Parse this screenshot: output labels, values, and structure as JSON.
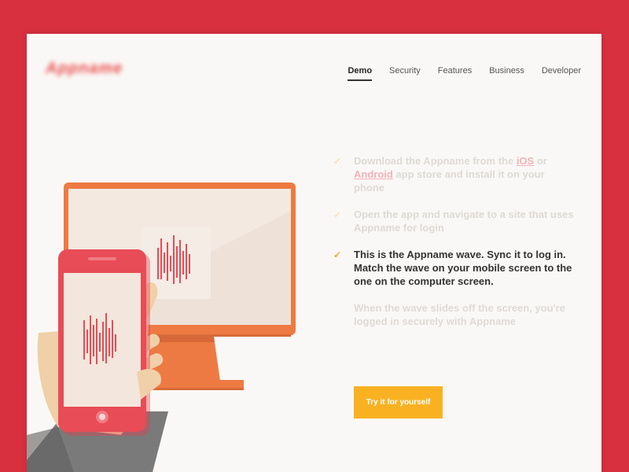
{
  "brand": {
    "logo_text": "Appname"
  },
  "nav": {
    "items": [
      {
        "label": "Demo",
        "active": true
      },
      {
        "label": "Security"
      },
      {
        "label": "Features"
      },
      {
        "label": "Business"
      },
      {
        "label": "Developer"
      }
    ]
  },
  "steps": {
    "step1": {
      "before": "Download the Appname from the ",
      "ios": "iOS",
      "or": " or ",
      "android": "Android",
      "after": " app store and install it on your phone"
    },
    "step2": "Open the app and navigate to a site that uses Appname for login",
    "step3": "This is the Appname wave. Sync it to log in. Match the wave on your mobile screen to the one on the computer screen.",
    "step4": "When the wave slides off the screen, you're logged in securely with Appname"
  },
  "cta": {
    "label": "Try it for yourself"
  },
  "colors": {
    "background": "#d8303f",
    "page": "#faf8f6",
    "accent": "#f9b122",
    "monitor": "#ee7a43",
    "phone": "#e84c56"
  },
  "icons": {
    "check": "checkmark-icon"
  }
}
